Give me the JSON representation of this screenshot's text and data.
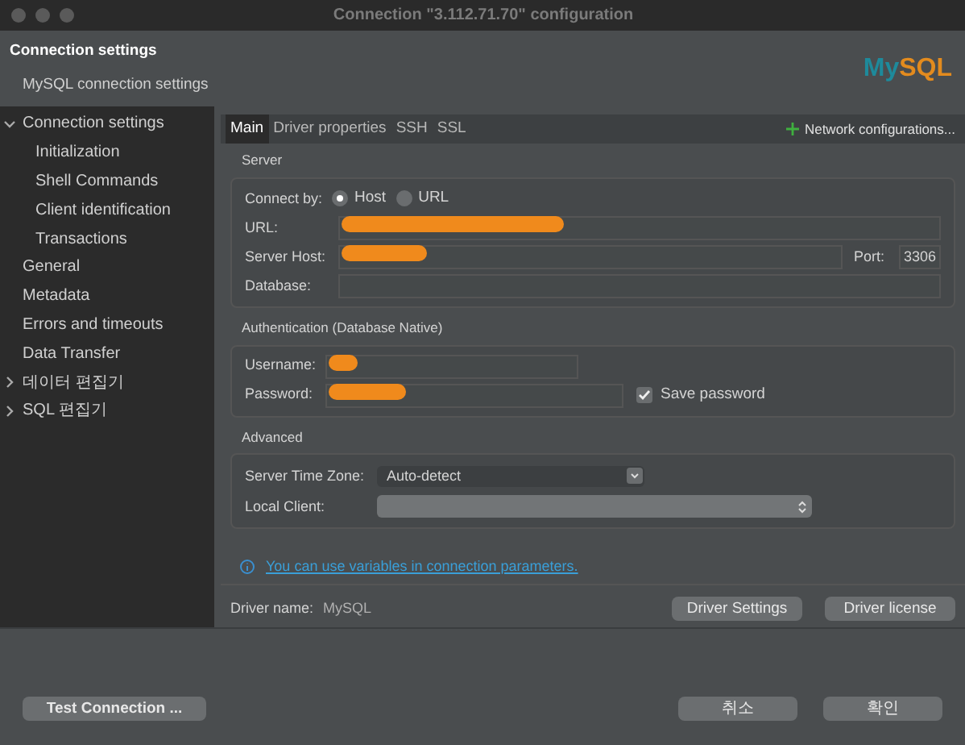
{
  "window": {
    "title": "Connection \"3.112.71.70\" configuration"
  },
  "header": {
    "title": "Connection settings",
    "subtitle": "MySQL connection settings",
    "logo": "MySQL"
  },
  "sidebar": {
    "items": [
      {
        "label": "Connection settings",
        "expanded": true,
        "children": [
          {
            "label": "Initialization"
          },
          {
            "label": "Shell Commands"
          },
          {
            "label": "Client identification"
          },
          {
            "label": "Transactions"
          }
        ]
      },
      {
        "label": "General"
      },
      {
        "label": "Metadata"
      },
      {
        "label": "Errors and timeouts"
      },
      {
        "label": "Data Transfer"
      },
      {
        "label": "데이터 편집기",
        "expanded": false
      },
      {
        "label": "SQL 편집기",
        "expanded": false
      }
    ]
  },
  "tabs": [
    {
      "label": "Main",
      "selected": true
    },
    {
      "label": "Driver properties",
      "selected": false
    },
    {
      "label": "SSH",
      "selected": false
    },
    {
      "label": "SSL",
      "selected": false
    }
  ],
  "network_button": "Network configurations...",
  "server": {
    "title": "Server",
    "connect_by_label": "Connect by:",
    "connect_by": [
      {
        "label": "Host",
        "selected": true
      },
      {
        "label": "URL",
        "selected": false
      }
    ],
    "url_label": "URL:",
    "host_label": "Server Host:",
    "port_label": "Port:",
    "port": "3306",
    "database_label": "Database:"
  },
  "auth": {
    "title": "Authentication (Database Native)",
    "username_label": "Username:",
    "password_label": "Password:",
    "save_password": {
      "label": "Save password",
      "checked": true
    }
  },
  "advanced": {
    "title": "Advanced",
    "timezone_label": "Server Time Zone:",
    "timezone": "Auto-detect",
    "local_client_label": "Local Client:"
  },
  "info_link": "You can use variables in connection parameters.",
  "driver": {
    "label": "Driver name:",
    "name": "MySQL",
    "buttons": [
      "Driver Settings",
      "Driver license"
    ]
  },
  "footer": {
    "test_button": "Test Connection ...",
    "buttons": [
      "취소",
      "확인"
    ]
  }
}
